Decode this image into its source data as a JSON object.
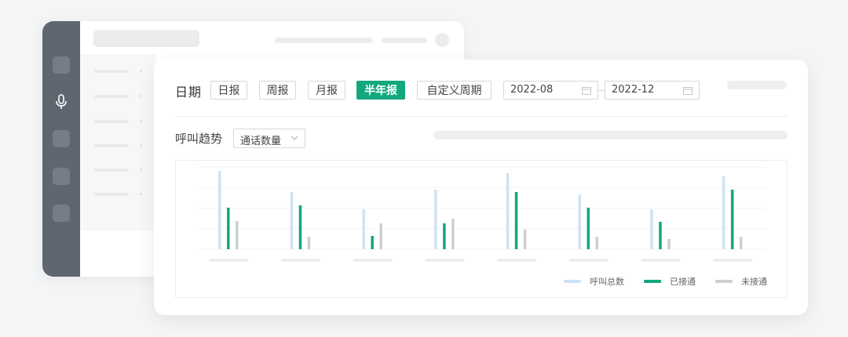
{
  "colors": {
    "sidebar": "#5f6670",
    "accent": "#13a77d",
    "total_series": "#cfe2f5",
    "answered_series": "#13a77d",
    "missed_series": "#cfd0d3"
  },
  "sidebar": {
    "icons": [
      "app-icon",
      "microphone-icon",
      "app-icon",
      "app-icon",
      "app-icon"
    ]
  },
  "filters": {
    "date_label": "日期",
    "tabs": [
      "日报",
      "周报",
      "月报",
      "半年报",
      "自定义周期"
    ],
    "active_tab": "半年报",
    "start_date": "2022-08",
    "end_date": "2022-12"
  },
  "trend": {
    "label": "呼叫趋势",
    "metric_selected": "通话数量"
  },
  "chart_data": {
    "type": "bar",
    "categories": [
      "",
      "",
      "",
      "",
      "",
      "",
      "",
      ""
    ],
    "series": [
      {
        "name": "呼叫总数",
        "values": [
          100,
          73,
          51,
          76,
          97,
          70,
          51,
          93
        ]
      },
      {
        "name": "已接通",
        "values": [
          53,
          56,
          17,
          33,
          73,
          53,
          35,
          76
        ]
      },
      {
        "name": "未接通",
        "values": [
          36,
          16,
          33,
          39,
          25,
          16,
          13,
          16
        ]
      }
    ],
    "ylim": [
      0,
      105
    ],
    "grid": true,
    "legend": "bottom-right",
    "title": "",
    "xlabel": "",
    "ylabel": ""
  }
}
